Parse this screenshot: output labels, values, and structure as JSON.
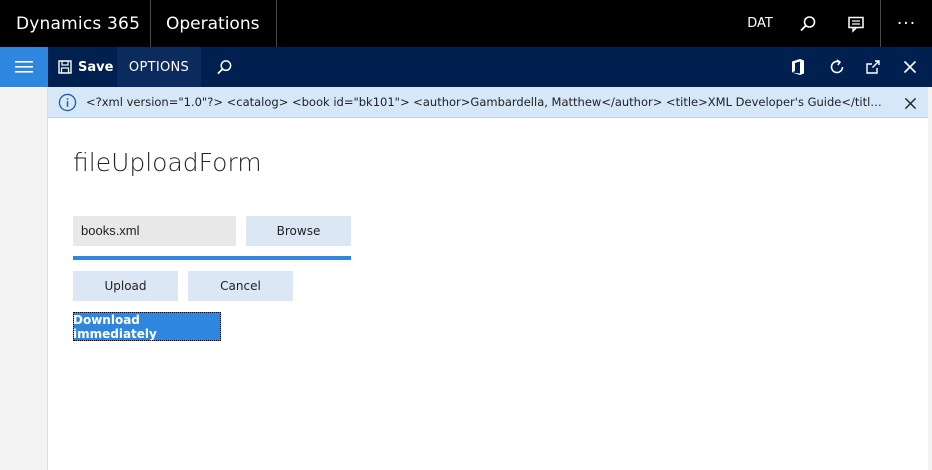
{
  "topbar": {
    "brand": "Dynamics 365",
    "module": "Operations",
    "company": "DAT",
    "more": "···"
  },
  "actionbar": {
    "save_label": "Save",
    "options_label": "OPTIONS"
  },
  "infobar": {
    "message": "<?xml version=\"1.0\"?> <catalog> <book id=\"bk101\"> <author>Gambardella, Matthew</author> <title>XML Developer's Guide</title> <genre>Co..."
  },
  "form": {
    "title": "fileUploadForm",
    "file_value": "books.xml",
    "browse_label": "Browse",
    "upload_label": "Upload",
    "cancel_label": "Cancel",
    "download_label": "Download immediately",
    "upload_progress": 1.0
  },
  "colors": {
    "topbar_bg": "#000000",
    "actionbar_bg": "#002050",
    "accent": "#2e86de",
    "info_bg": "#d6e7f8",
    "button_light": "#dbe7f4"
  }
}
